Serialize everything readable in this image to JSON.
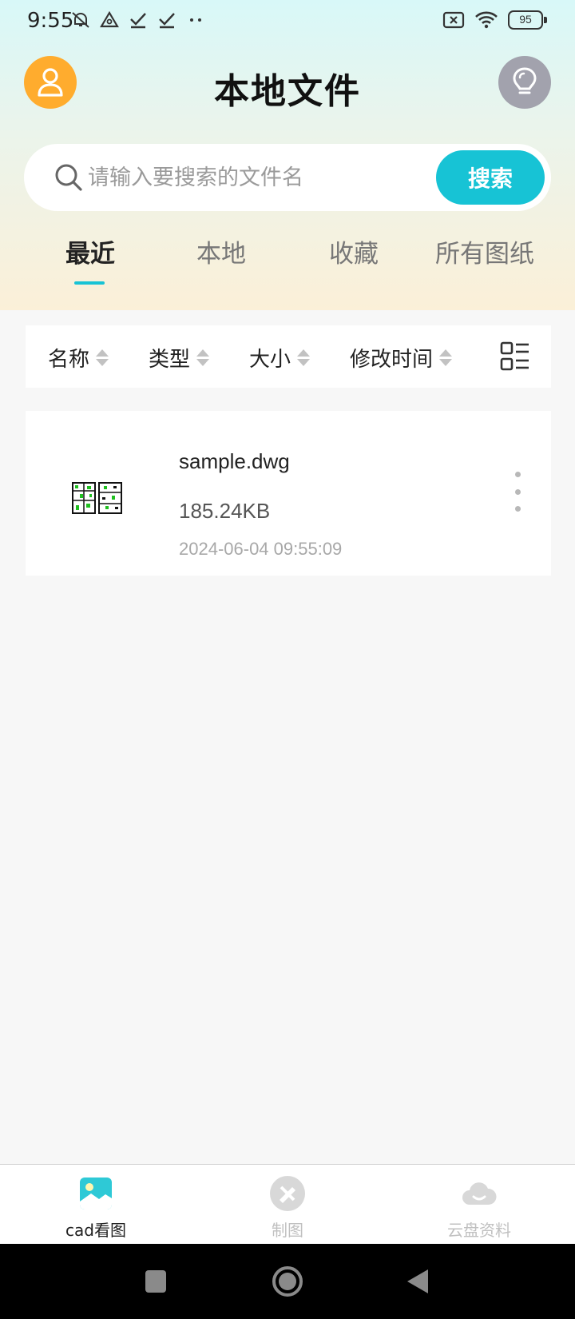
{
  "status_bar": {
    "time": "9:55",
    "battery": "95",
    "icons_left": [
      "mute-bell-icon",
      "triangle-icon",
      "check-icon",
      "check-icon",
      "dots-icon"
    ],
    "icons_right": [
      "no-sim-icon",
      "wifi-icon",
      "battery-icon"
    ]
  },
  "header": {
    "title": "本地文件",
    "left_button_icon": "user-icon",
    "right_button_icon": "lightbulb-icon"
  },
  "search": {
    "placeholder": "请输入要搜索的文件名",
    "value": "",
    "button_label": "搜索"
  },
  "tabs": [
    {
      "label": "最近",
      "active": true
    },
    {
      "label": "本地",
      "active": false
    },
    {
      "label": "收藏",
      "active": false
    },
    {
      "label": "所有图纸",
      "active": false
    }
  ],
  "sort_bar": {
    "items": [
      "名称",
      "类型",
      "大小",
      "修改时间"
    ],
    "view_toggle_icon": "list-view-icon"
  },
  "files": [
    {
      "name": "sample.dwg",
      "size": "185.24KB",
      "modified": "2024-06-04 09:55:09",
      "thumb_icon": "dwg-thumbnail-icon"
    }
  ],
  "bottom_nav": [
    {
      "label": "cad看图",
      "icon": "image-icon",
      "active": true
    },
    {
      "label": "制图",
      "icon": "drafting-icon",
      "active": false
    },
    {
      "label": "云盘资料",
      "icon": "cloud-icon",
      "active": false
    }
  ],
  "colors": {
    "accent": "#17c3d5",
    "avatar_bg": "#ffac2e",
    "bulb_bg": "#a2a2ad"
  }
}
